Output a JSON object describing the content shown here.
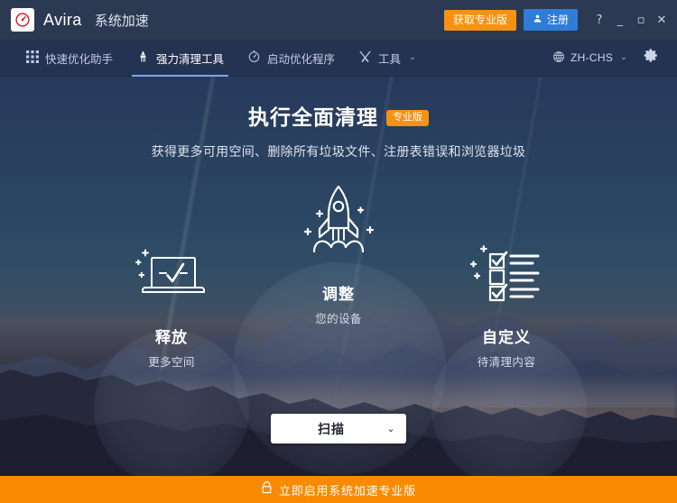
{
  "window": {
    "brand": "Avira",
    "product": "系统加速",
    "logo_icon": "avira-speedometer-logo",
    "get_pro_label": "获取专业版",
    "register_label": "注册",
    "register_icon": "user-icon",
    "help_label": "?",
    "minimize_label": "_",
    "maximize_label": "▫",
    "close_label": "✕"
  },
  "nav": {
    "items": [
      {
        "label": "快速优化助手",
        "icon": "grid-icon",
        "active": false
      },
      {
        "label": "强力清理工具",
        "icon": "brush-icon",
        "active": true
      },
      {
        "label": "启动优化程序",
        "icon": "speedometer-icon",
        "active": false
      },
      {
        "label": "工具",
        "icon": "tools-icon",
        "active": false,
        "caret": "⌄"
      }
    ],
    "language": {
      "label": "ZH-CHS",
      "icon": "globe-icon",
      "caret": "⌄"
    },
    "settings_icon": "gear-icon"
  },
  "hero": {
    "title": "执行全面清理",
    "badge": "专业版",
    "subtitle": "获得更多可用空间、删除所有垃圾文件、注册表错误和浏览器垃圾"
  },
  "features": [
    {
      "key": "free-space",
      "icon": "laptop-check-icon",
      "title": "释放",
      "desc": "更多空间"
    },
    {
      "key": "tune-device",
      "icon": "rocket-icon",
      "title": "调整",
      "desc": "您的设备"
    },
    {
      "key": "customize",
      "icon": "checklist-icon",
      "title": "自定义",
      "desc": "待清理内容"
    }
  ],
  "scan": {
    "label": "扫描",
    "caret": "⌄"
  },
  "footer": {
    "icon": "lock-icon",
    "label": "立即启用系统加速专业版"
  },
  "colors": {
    "accent_orange": "#f59212",
    "footer_orange": "#f88a00",
    "register_blue": "#2e7dd7",
    "titlebar": "#2b3952",
    "navbar": "#253352",
    "active_underline": "#7ba7e8"
  }
}
